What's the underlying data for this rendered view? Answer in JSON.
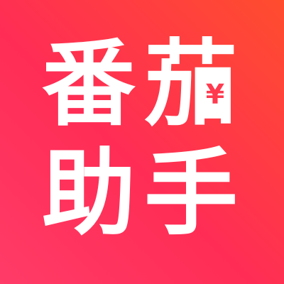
{
  "logo": {
    "line1": [
      "番",
      "茄"
    ],
    "line2": [
      "助",
      "手"
    ],
    "currency_symbol": "¥"
  },
  "colors": {
    "gradient_start": "#ff4d2e",
    "gradient_mid": "#ff2d55",
    "gradient_end": "#ff3b67",
    "text": "#ffffff",
    "badge_text": "#ff3a4f"
  }
}
